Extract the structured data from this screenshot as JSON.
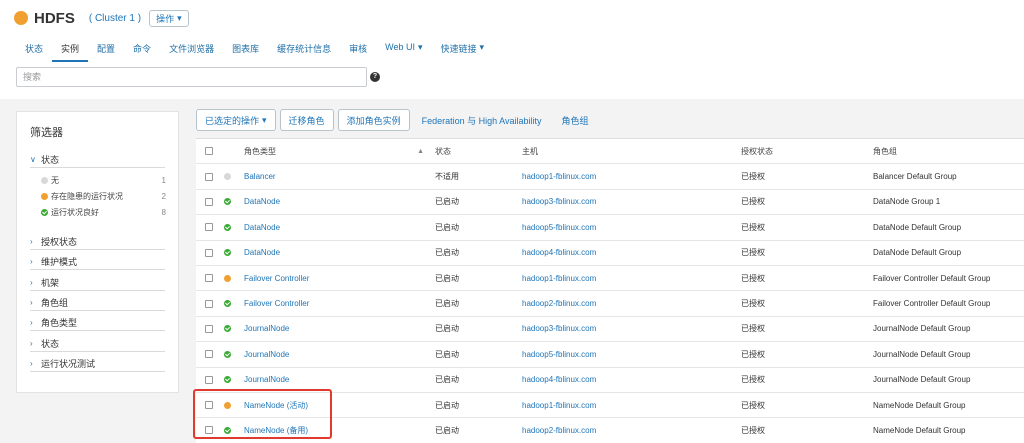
{
  "service": {
    "name": "HDFS",
    "cluster": "( Cluster 1 )",
    "actions_label": "操作",
    "status_color": "#f0a030"
  },
  "tabs": [
    {
      "label": "状态"
    },
    {
      "label": "实例"
    },
    {
      "label": "配置"
    },
    {
      "label": "命令"
    },
    {
      "label": "文件浏览器"
    },
    {
      "label": "图表库"
    },
    {
      "label": "缓存统计信息"
    },
    {
      "label": "审核"
    },
    {
      "label": "Web UI"
    },
    {
      "label": "快速链接"
    }
  ],
  "active_tab": "实例",
  "search": {
    "placeholder": "搜索",
    "value": ""
  },
  "help_icon": "?",
  "sidebar": {
    "title": "筛选器",
    "status_section": "状态",
    "status_items": [
      {
        "label": "无",
        "count": "1",
        "dot": "grey"
      },
      {
        "label": "存在隐患的运行状况",
        "count": "2",
        "dot": "orange"
      },
      {
        "label": "运行状况良好",
        "count": "8",
        "dot": "green"
      }
    ],
    "collapsed_sections": [
      "授权状态",
      "维护模式",
      "机架",
      "角色组",
      "角色类型",
      "状态",
      "运行状况测试"
    ]
  },
  "toolbar": {
    "selected_actions": "已选定的操作",
    "migrate_role": "迁移角色",
    "add_role_instance": "添加角色实例",
    "federation": "Federation 与 High Availability",
    "role_groups": "角色组"
  },
  "table": {
    "headers": {
      "role_type": "角色类型",
      "status": "状态",
      "host": "主机",
      "commission": "授权状态",
      "role_group": "角色组"
    },
    "rows": [
      {
        "health": "grey",
        "role_type": "Balancer",
        "status": "不适用",
        "host": "hadoop1-fblinux.com",
        "commission": "已授权",
        "role_group": "Balancer Default Group"
      },
      {
        "health": "green",
        "role_type": "DataNode",
        "status": "已启动",
        "host": "hadoop3-fblinux.com",
        "commission": "已授权",
        "role_group": "DataNode Group 1"
      },
      {
        "health": "green",
        "role_type": "DataNode",
        "status": "已启动",
        "host": "hadoop5-fblinux.com",
        "commission": "已授权",
        "role_group": "DataNode Default Group"
      },
      {
        "health": "green",
        "role_type": "DataNode",
        "status": "已启动",
        "host": "hadoop4-fblinux.com",
        "commission": "已授权",
        "role_group": "DataNode Default Group"
      },
      {
        "health": "orange",
        "role_type": "Failover Controller",
        "status": "已启动",
        "host": "hadoop1-fblinux.com",
        "commission": "已授权",
        "role_group": "Failover Controller Default Group"
      },
      {
        "health": "green",
        "role_type": "Failover Controller",
        "status": "已启动",
        "host": "hadoop2-fblinux.com",
        "commission": "已授权",
        "role_group": "Failover Controller Default Group"
      },
      {
        "health": "green",
        "role_type": "JournalNode",
        "status": "已启动",
        "host": "hadoop3-fblinux.com",
        "commission": "已授权",
        "role_group": "JournalNode Default Group"
      },
      {
        "health": "green",
        "role_type": "JournalNode",
        "status": "已启动",
        "host": "hadoop5-fblinux.com",
        "commission": "已授权",
        "role_group": "JournalNode Default Group"
      },
      {
        "health": "green",
        "role_type": "JournalNode",
        "status": "已启动",
        "host": "hadoop4-fblinux.com",
        "commission": "已授权",
        "role_group": "JournalNode Default Group"
      },
      {
        "health": "orange",
        "role_type": "NameNode (活动)",
        "status": "已启动",
        "host": "hadoop1-fblinux.com",
        "commission": "已授权",
        "role_group": "NameNode Default Group"
      },
      {
        "health": "green",
        "role_type": "NameNode (备用)",
        "status": "已启动",
        "host": "hadoop2-fblinux.com",
        "commission": "已授权",
        "role_group": "NameNode Default Group"
      }
    ]
  },
  "highlight_color": "#e03a2e"
}
